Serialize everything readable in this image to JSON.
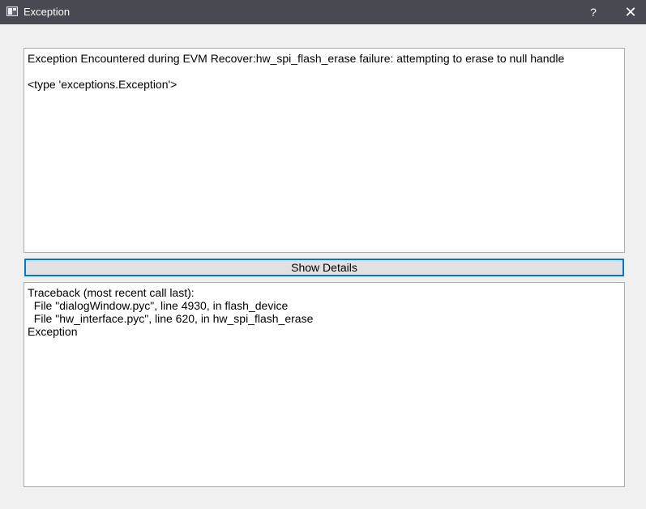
{
  "window": {
    "title": "Exception",
    "help_label": "?",
    "close_label": "✕",
    "icon": "window-app-icon"
  },
  "message": {
    "text": "Exception Encountered during EVM Recover:hw_spi_flash_erase failure: attempting to erase to null handle\n\n<type 'exceptions.Exception'>"
  },
  "details_button": {
    "label": "Show Details"
  },
  "traceback": {
    "text": "Traceback (most recent call last):\n  File \"dialogWindow.pyc\", line 4930, in flash_device\n  File \"hw_interface.pyc\", line 620, in hw_spi_flash_erase\nException"
  },
  "colors": {
    "titlebar": "#474b51",
    "focus_border": "#0078d7",
    "background": "#f0f0f0"
  }
}
